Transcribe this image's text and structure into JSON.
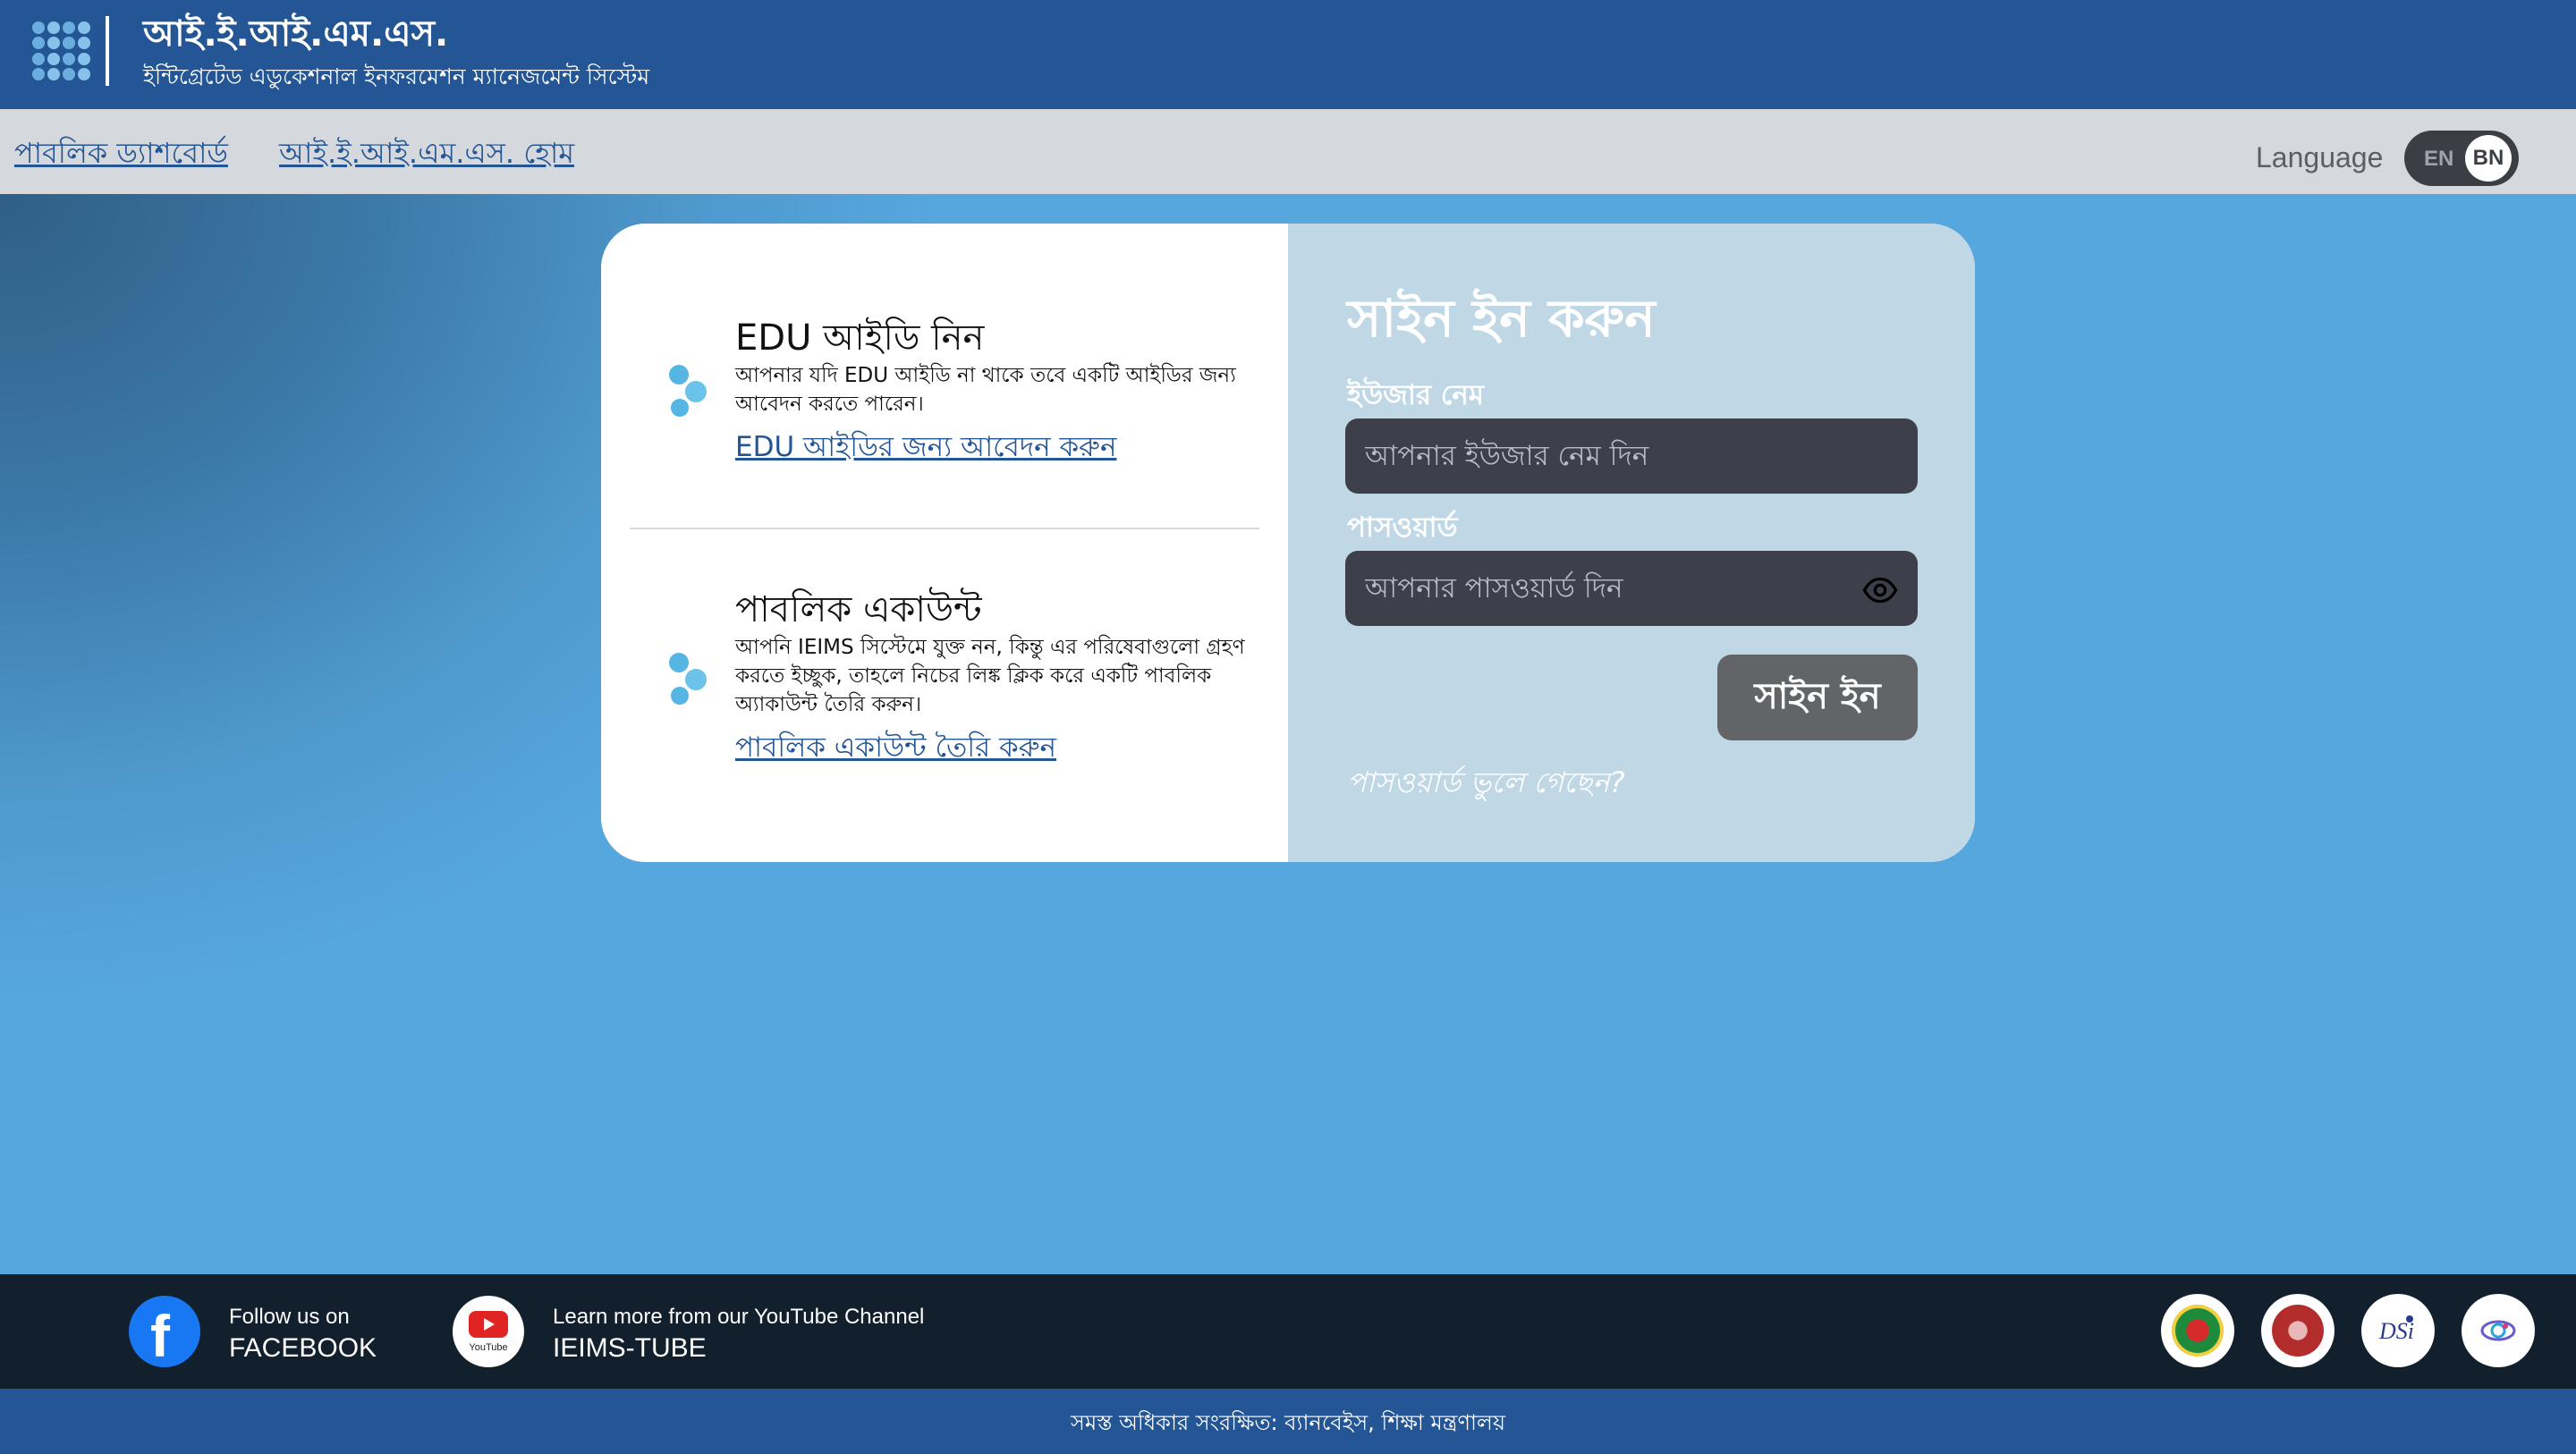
{
  "header": {
    "title": "আই.ই.আই.এম.এস.",
    "subtitle": "ইন্টিগ্রেটেড এডুকেশনাল ইনফরমেশন ম্যানেজমেন্ট সিস্টেম"
  },
  "nav": {
    "links": [
      {
        "label": "পাবলিক ড্যাশবোর্ড"
      },
      {
        "label": "আই.ই.আই.এম.এস. হোম"
      }
    ],
    "language_label": "Language",
    "language_options": [
      "EN",
      "BN"
    ],
    "language_selected": "BN"
  },
  "card": {
    "edu": {
      "title": "EDU আইডি নিন",
      "text": "আপনার যদি EDU আইডি না থাকে তবে একটি আইডির জন্য আবেদন করতে পারেন।",
      "link": "EDU আইডির জন্য আবেদন করুন"
    },
    "public": {
      "title": "পাবলিক একাউন্ট",
      "text": "আপনি IEIMS সিস্টেমে যুক্ত নন, কিন্তু এর পরিষেবাগুলো গ্রহণ করতে ইচ্ছুক, তাহলে নিচের লিঙ্ক ক্লিক করে একটি পাবলিক অ্যাকাউন্ট তৈরি করুন।",
      "link": "পাবলিক একাউন্ট তৈরি করুন"
    },
    "signin": {
      "title": "সাইন ইন করুন",
      "username_label": "ইউজার নেম",
      "username_placeholder": "আপনার ইউজার নেম দিন",
      "password_label": "পাসওয়ার্ড",
      "password_placeholder": "আপনার পাসওয়ার্ড দিন",
      "button": "সাইন ইন",
      "forgot": "পাসওয়ার্ড ভুলে গেছেন?"
    }
  },
  "footer": {
    "facebook_small": "Follow us on",
    "facebook_big": "FACEBOOK",
    "youtube_small": "Learn more from our YouTube Channel",
    "youtube_big": "IEIMS-TUBE",
    "youtube_icon_text": "YouTube",
    "copyright": "সমস্ত অধিকার সংরক্ষিত: ব্যানবেইস, শিক্ষা মন্ত্রণালয়"
  },
  "colors": {
    "header": "#245695",
    "nav": "#d5d8dd",
    "accent_link": "#245695",
    "signin_panel": "#c0d8e6",
    "footer": "#12202d"
  }
}
